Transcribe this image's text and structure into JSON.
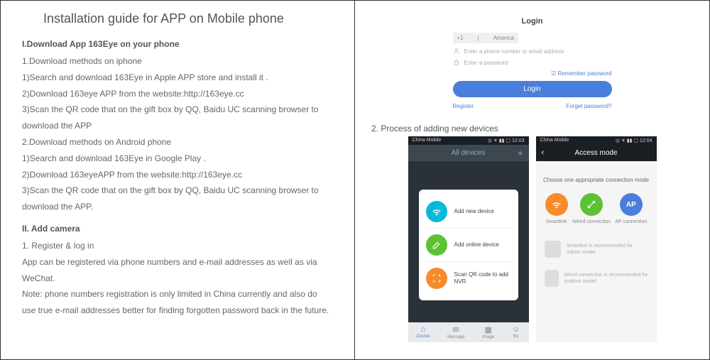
{
  "left": {
    "title": "Installation guide for APP on Mobile phone",
    "section1": "I.Download App 163Eye on your phone",
    "s1_l1": "1.Download methods on iphone",
    "s1_l2": "1)Search and download  163Eye in Apple APP store and install it .",
    "s1_l3": "2)Download 163eye APP from the website:http://163eye.cc",
    "s1_l4": "3)Scan the QR code that on the gift box by QQ, Baidu UC scanning browser to download the APP",
    "s1_l5": "2.Download methods on Android phone",
    "s1_l6": "1)Search and download 163Eye in Google Play .",
    "s1_l7": "2)Download 163eyeAPP from the website:http://163eye.cc",
    "s1_l8": "3)Scan the QR code that on the gift box by QQ, Baidu UC scanning browser to download the APP.",
    "section2": "II. Add camera",
    "s2_l1": "1. Register & log in",
    "s2_l2": "App can be registered via phone numbers and e-mail addresses as well as via WeChat.",
    "s2_l3": "Note: phone numbers registration is only limited in China currently and also do use true e-mail addresses better for finding forgotten password back in the future."
  },
  "login": {
    "title": "Login",
    "code": "+1",
    "country": "America",
    "phone_ph": "Enter a phone number or email address",
    "pass_ph": "Enter  a  password",
    "remember": "Remember password",
    "btn": "Login",
    "register": "Register",
    "forget": "Forget password?"
  },
  "section2_label": "2. Process of adding new devices",
  "phone1": {
    "carrier": "China Mobile",
    "time": "12:03",
    "nav": "All devices",
    "row1": "Add new device",
    "row2": "Add online device",
    "row3": "Scan QR code to add NVR",
    "bn1": "Device",
    "bn2": "Message",
    "bn3": "Image",
    "bn4": "My"
  },
  "phone2": {
    "carrier": "China Mobile",
    "time": "12:04",
    "nav": "Access mode",
    "prompt": "Choose one appropriate connection mode",
    "opt1": "Smartlink",
    "opt2": "Wired connection",
    "opt3": "AP connection",
    "cam1": "Smartlink is recommended for indoor model",
    "cam2": "Wired connection is recommended for outdoor model"
  }
}
